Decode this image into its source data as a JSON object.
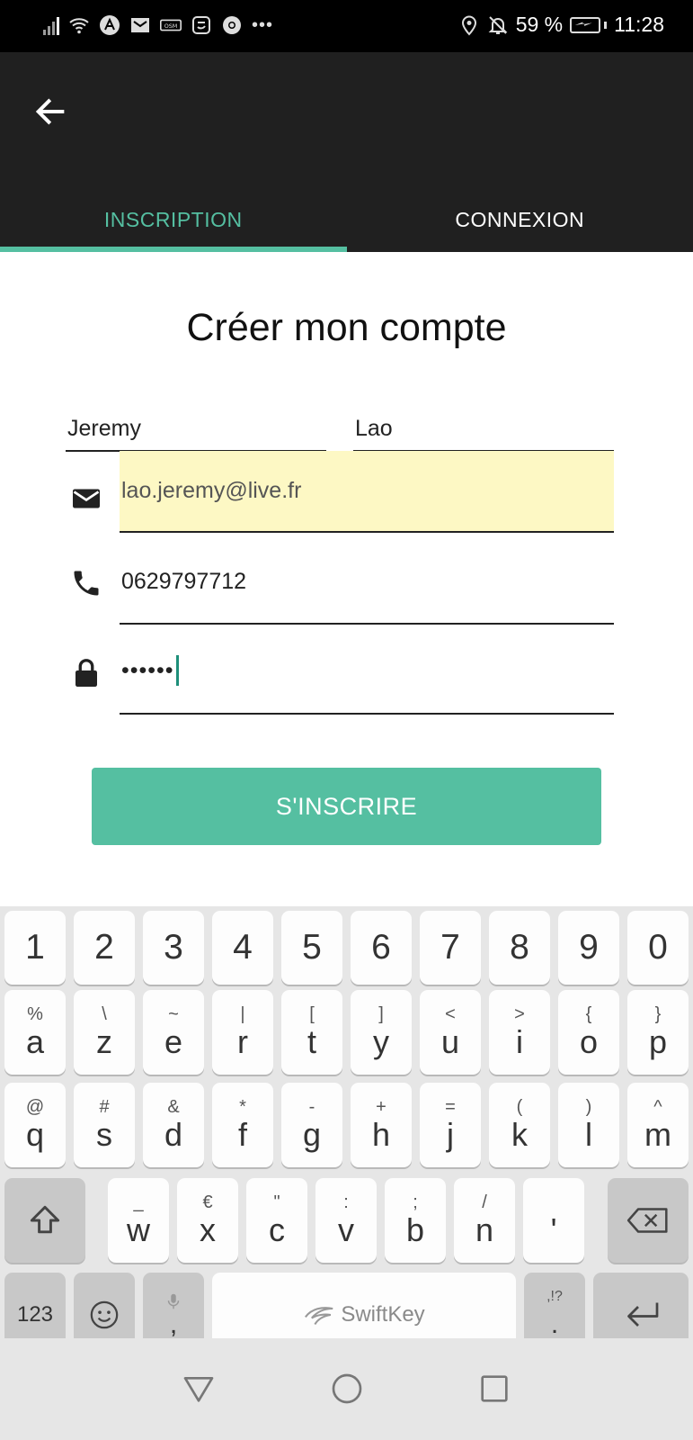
{
  "status_bar": {
    "battery_text": "59 %",
    "time": "11:28",
    "more": "•••",
    "icons": [
      "signal-icon",
      "wifi-icon",
      "app-a-icon",
      "mail-icon",
      "osm-icon",
      "app-icon",
      "chrome-icon",
      "location-icon",
      "bell-off-icon",
      "battery-icon"
    ]
  },
  "toolbar": {
    "back_icon": "arrow-left-icon",
    "tabs": [
      {
        "label": "INSCRIPTION",
        "active": true
      },
      {
        "label": "CONNEXION",
        "active": false
      }
    ]
  },
  "form": {
    "title": "Créer mon compte",
    "first_name": "Jeremy",
    "last_name": "Lao",
    "email": "lao.jeremy@live.fr",
    "phone": "0629797712",
    "password_masked": "••••••",
    "submit_label": "S'INSCRIRE"
  },
  "keyboard": {
    "numbers": [
      "1",
      "2",
      "3",
      "4",
      "5",
      "6",
      "7",
      "8",
      "9",
      "0"
    ],
    "row1": [
      {
        "sec": "%",
        "pri": "a"
      },
      {
        "sec": "\\",
        "pri": "z"
      },
      {
        "sec": "~",
        "pri": "e"
      },
      {
        "sec": "|",
        "pri": "r"
      },
      {
        "sec": "[",
        "pri": "t"
      },
      {
        "sec": "]",
        "pri": "y"
      },
      {
        "sec": "<",
        "pri": "u"
      },
      {
        "sec": ">",
        "pri": "i"
      },
      {
        "sec": "{",
        "pri": "o"
      },
      {
        "sec": "}",
        "pri": "p"
      }
    ],
    "row2": [
      {
        "sec": "@",
        "pri": "q"
      },
      {
        "sec": "#",
        "pri": "s"
      },
      {
        "sec": "&",
        "pri": "d"
      },
      {
        "sec": "*",
        "pri": "f"
      },
      {
        "sec": "-",
        "pri": "g"
      },
      {
        "sec": "+",
        "pri": "h"
      },
      {
        "sec": "=",
        "pri": "j"
      },
      {
        "sec": "(",
        "pri": "k"
      },
      {
        "sec": ")",
        "pri": "l"
      },
      {
        "sec": "^",
        "pri": "m"
      }
    ],
    "row3": [
      {
        "sec": "_",
        "pri": "w"
      },
      {
        "sec": "€",
        "pri": "x"
      },
      {
        "sec": "\"",
        "pri": "c"
      },
      {
        "sec": ":",
        "pri": "v"
      },
      {
        "sec": ";",
        "pri": "b"
      },
      {
        "sec": "/",
        "pri": "n"
      },
      {
        "sec": "",
        "pri": "'"
      }
    ],
    "mode_label": "123",
    "comma_label": ",",
    "punct_sec": ",!?",
    "period_label": ".",
    "space_brand": "SwiftKey"
  },
  "colors": {
    "accent": "#55bfa1",
    "toolbar_bg": "#202020",
    "autofill_bg": "#fdf8c4"
  }
}
